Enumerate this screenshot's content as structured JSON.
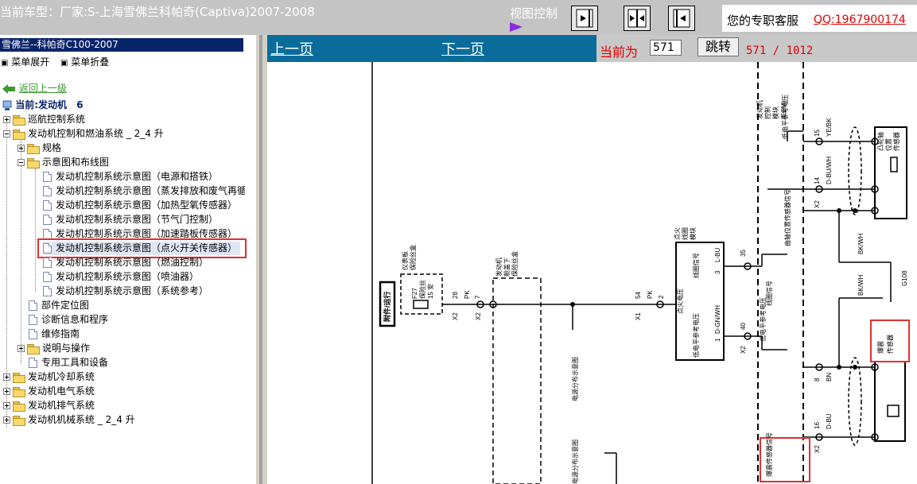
{
  "header": {
    "vehicle": "当前车型：厂家:S-上海雪佛兰科帕奇(Captiva)2007-2008",
    "view_control": "视图控制",
    "service_label": "您的专职客服",
    "service_qq": "QQ:1967900174"
  },
  "tree": {
    "title": "雪佛兰--科帕奇C100-2007",
    "expand_all": "菜单展开",
    "collapse_all": "菜单折叠",
    "back": "返回上一级",
    "current": "当前:发动机",
    "current_num": "6",
    "items": [
      "巡航控制系统",
      "发动机控制和燃油系统 _ 2_4 升",
      "规格",
      "示意图和布线图",
      "发动机控制系统示意图（电源和搭铁）",
      "发动机控制系统示意图（蒸发排放和废气再循",
      "发动机控制系统示意图（加热型氧传感器）",
      "发动机控制系统示意图（节气门控制）",
      "发动机控制系统示意图（加速踏板传感器）",
      "发动机控制系统示意图（点火开关传感器）",
      "发动机控制系统示意图（燃油控制）",
      "发动机控制系统示意图（喷油器）",
      "发动机控制系统示意图（系统参考）",
      "部件定位图",
      "诊断信息和程序",
      "维修指南",
      "说明与操作",
      "专用工具和设备",
      "发动机冷却系统",
      "发动机电气系统",
      "发动机排气系统",
      "发动机机械系统 _ 2_4 升"
    ]
  },
  "nav": {
    "prev": "上一页",
    "next": "下一页",
    "current_label": "当前为",
    "current_page": "571",
    "jump": "跳转",
    "page_count": "571 / 1012"
  },
  "diagram": {
    "ign": "附件/运行",
    "fuse_label1": "仪表板",
    "fuse_label2": "保险丝盒",
    "fuse_f27": "F27",
    "fuse_name": "保险丝",
    "fuse_15a": "15 安",
    "w28": "28",
    "pk": "PK",
    "w7": "7",
    "x2": "X2",
    "eng1": "发动机",
    "eng2": "舱盖下",
    "eng3": "保险丝盒",
    "w54": "54",
    "w2": "2",
    "x1": "X1",
    "pwr_dist": "电源分布示意图",
    "ign_coil1": "点火",
    "ign_coil2": "线圈",
    "ign_coil3": "模块",
    "coil_sig": "线圈信号",
    "ign_v": "点火电压",
    "low_ref": "低电平参考电压",
    "lbu": "L-BU",
    "w3": "3",
    "w35": "35",
    "dgnwh": "D-GN/WH",
    "w1": "1",
    "w40": "40",
    "coil_sig2": "线圈信号",
    "low_ref2": "低电平参考电压",
    "ecm1": "发动机",
    "ecm2": "控制",
    "ecm3": "模块",
    "ecm4": "(ECM)",
    "low_ref3": "低电平参考电压",
    "w15": "15",
    "yebk": "YE/BK",
    "w14": "14",
    "dbuwh": "D-BU/WH",
    "cam_sig": "曲轴位置传感器信号",
    "bkwh": "BK/WH",
    "bkwh2": "BK/WH",
    "g108": "G108",
    "cam1": "凸轮轴",
    "cam2": "位置",
    "cam3": "传感器",
    "knock1": "爆震",
    "knock2": "传感器",
    "w8": "8",
    "bn": "BN",
    "w16": "16",
    "dbu": "D-BU",
    "knock_sig": "爆震传感器信号",
    "pwr_dist2": "电源分布示意图"
  }
}
